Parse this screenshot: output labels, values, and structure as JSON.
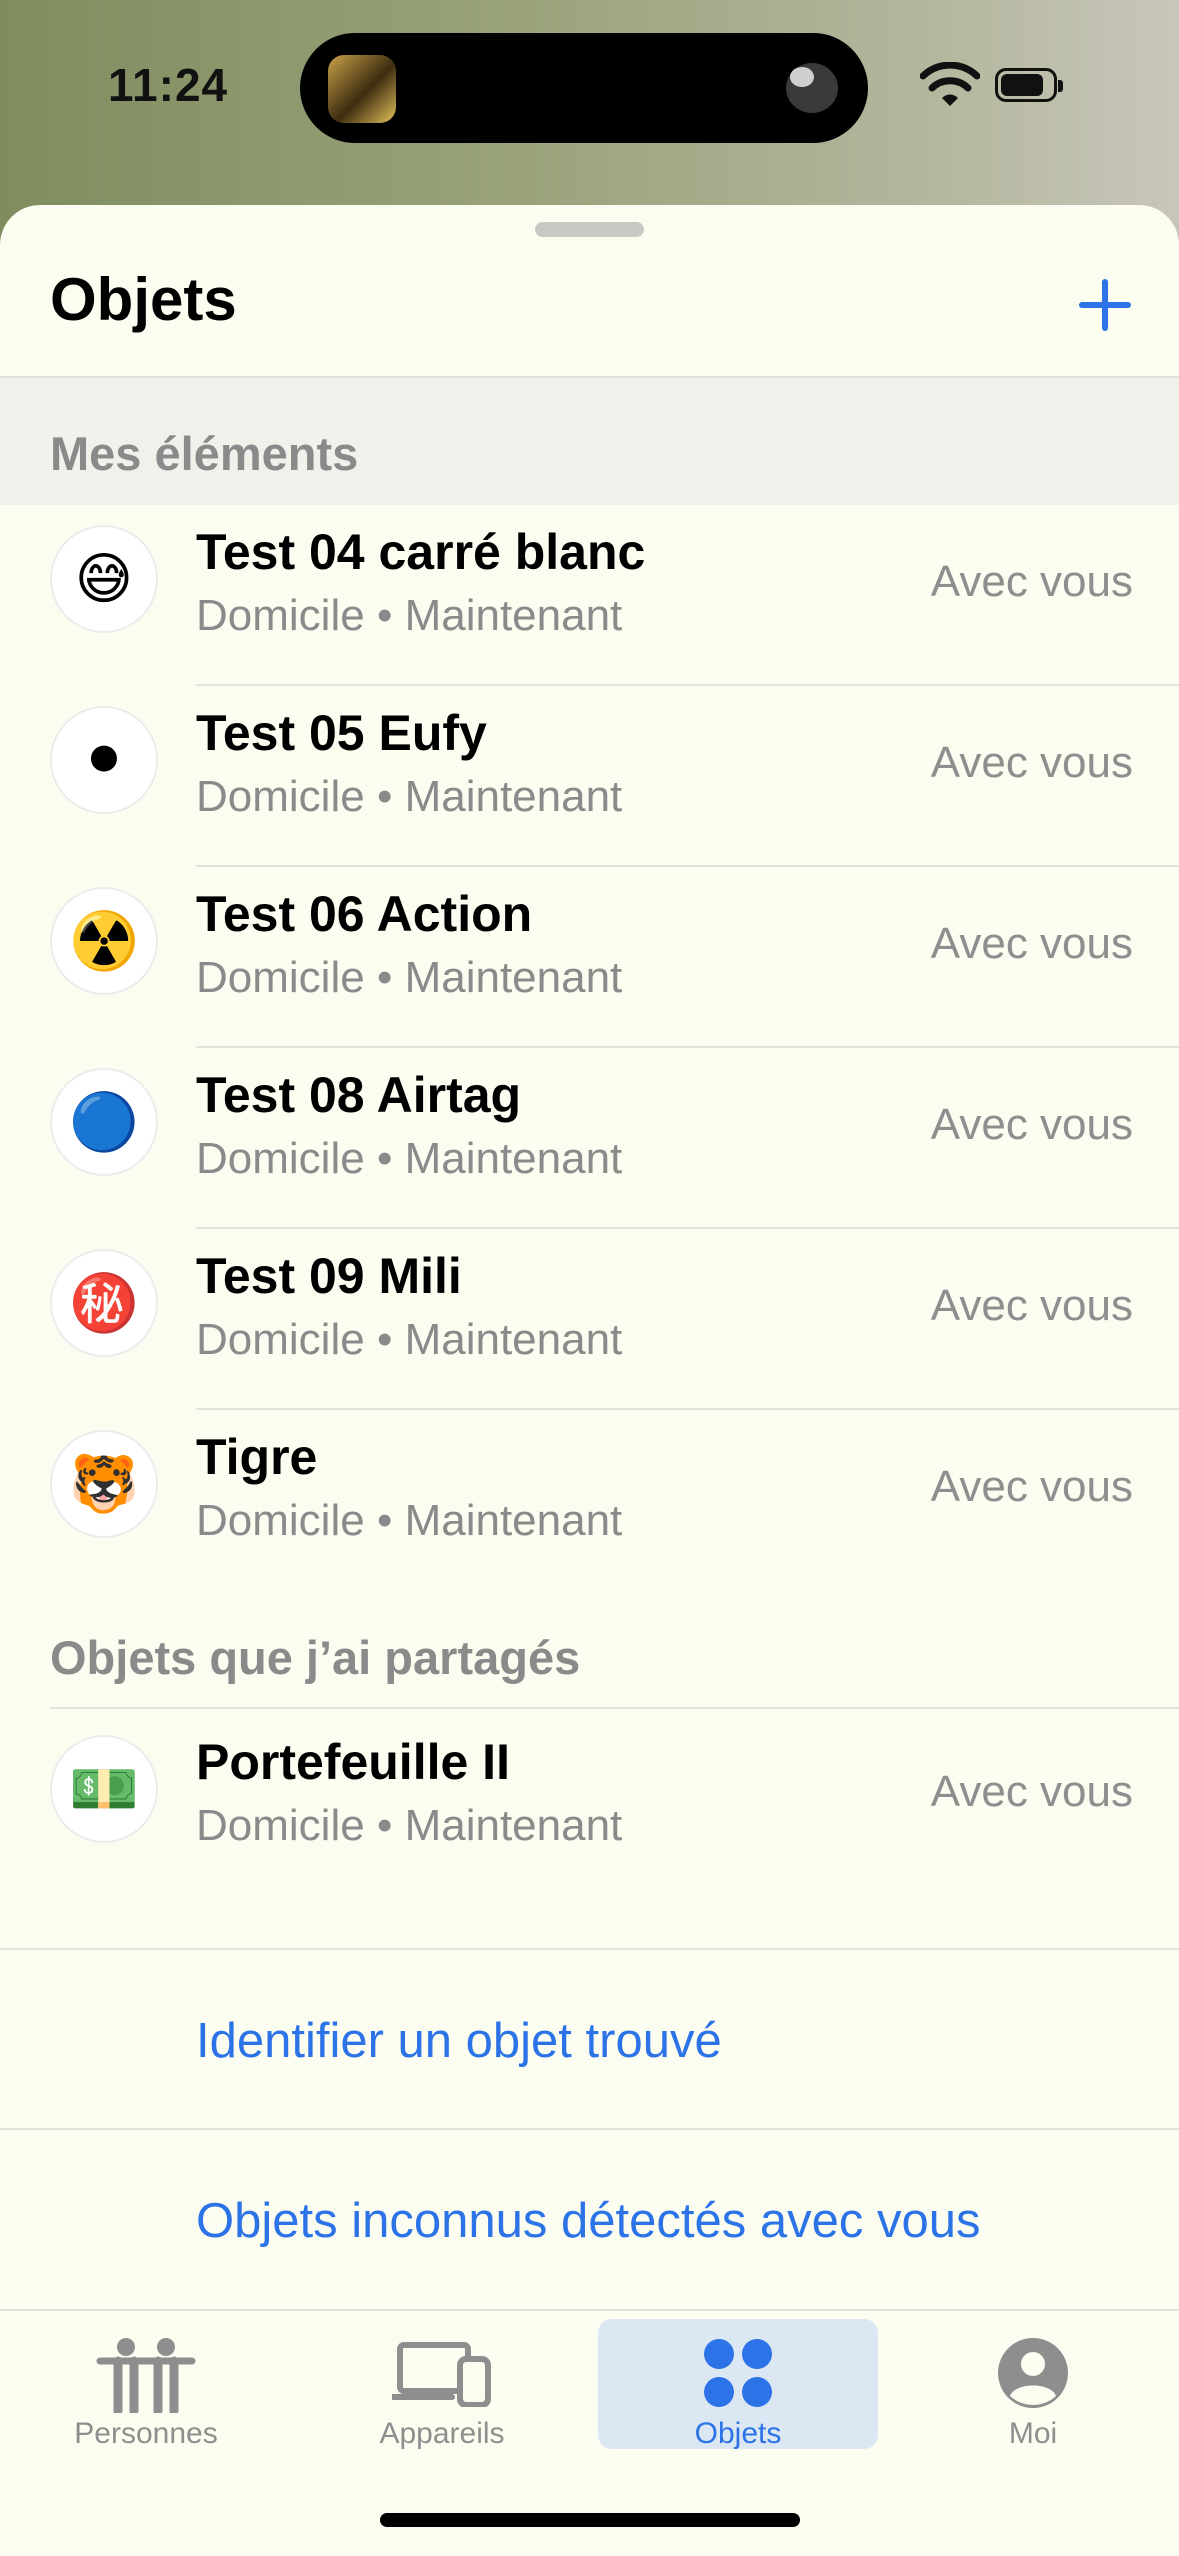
{
  "status_bar": {
    "time": "11:24"
  },
  "header": {
    "title": "Objets",
    "add_label": "+"
  },
  "sections": {
    "mine": "Mes éléments",
    "shared": "Objets que j’ai partagés"
  },
  "items": [
    {
      "emoji": "😅",
      "name": "Test 04 carré blanc",
      "location": "Domicile",
      "time": "Maintenant",
      "status": "Avec vous"
    },
    {
      "emoji": "⚫",
      "name": "Test 05 Eufy",
      "location": "Domicile",
      "time": "Maintenant",
      "status": "Avec vous"
    },
    {
      "emoji": "☢️",
      "name": "Test 06 Action",
      "location": "Domicile",
      "time": "Maintenant",
      "status": "Avec vous"
    },
    {
      "emoji": "🔵",
      "name": "Test 08 Airtag",
      "location": "Domicile",
      "time": "Maintenant",
      "status": "Avec vous"
    },
    {
      "emoji": "㊙️",
      "name": "Test 09 Mili",
      "location": "Domicile",
      "time": "Maintenant",
      "status": "Avec vous"
    },
    {
      "emoji": "🐯",
      "name": "Tigre",
      "location": "Domicile",
      "time": "Maintenant",
      "status": "Avec vous"
    }
  ],
  "shared_items": [
    {
      "emoji": "💵",
      "name": "Portefeuille II",
      "location": "Domicile",
      "time": "Maintenant",
      "status": "Avec vous"
    }
  ],
  "separator": "•",
  "links": {
    "identify": "Identifier un objet trouvé",
    "unknown": "Objets inconnus détectés avec vous"
  },
  "tabs": [
    {
      "label": "Personnes",
      "icon": "people-icon"
    },
    {
      "label": "Appareils",
      "icon": "devices-icon"
    },
    {
      "label": "Objets",
      "icon": "items-icon",
      "active": true
    },
    {
      "label": "Moi",
      "icon": "person-icon"
    }
  ],
  "colors": {
    "accent": "#2c73e8",
    "sheet": "#fcfdf1"
  }
}
